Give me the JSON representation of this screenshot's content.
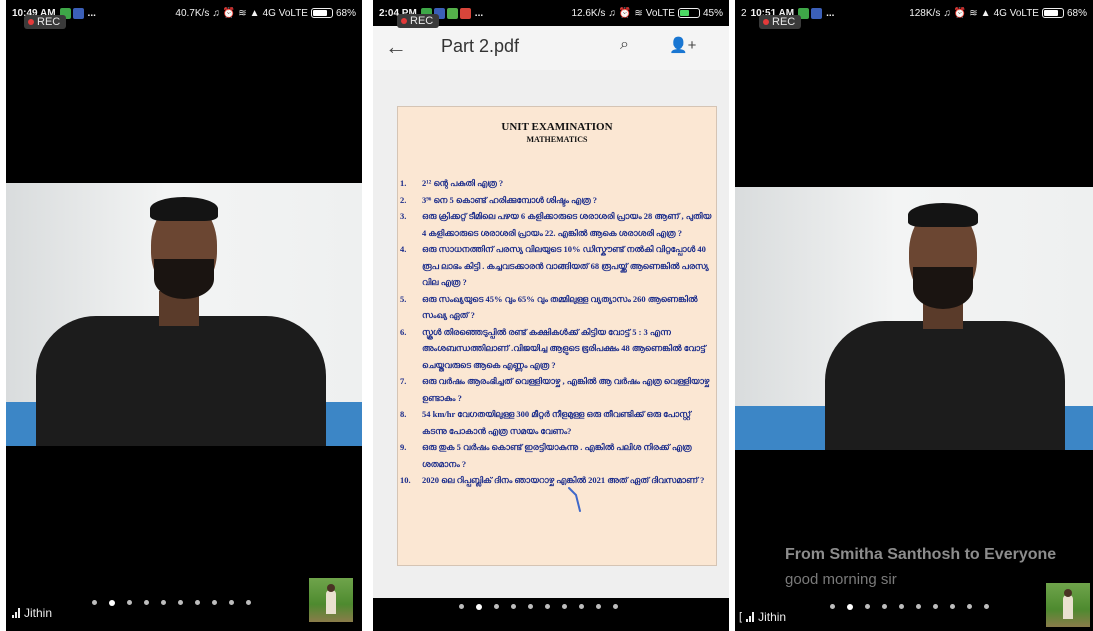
{
  "colors": {
    "rec_dot": "#e43a3a",
    "doc_text": "#182a8a",
    "floor_blue": "#3c86c6"
  },
  "panel1": {
    "status": {
      "time": "10:49 AM",
      "icons": [
        "gallery-icon",
        "facebook-icon"
      ],
      "more": "...",
      "speed": "40.7K/s",
      "network": "4G VoLTE",
      "battery": "68%",
      "battery_level": 0.68
    },
    "rec": "REC",
    "participant_name": "Jithin",
    "page_count": 10,
    "active_page": 1
  },
  "panel2": {
    "status": {
      "time": "2:04 PM",
      "icons": [
        "gallery-icon",
        "facebook-icon",
        "chat-icon",
        "mail-icon"
      ],
      "more": "...",
      "speed": "12.6K/s",
      "network": "VoLTE",
      "battery": "45%",
      "battery_level": 0.45
    },
    "rec": "REC",
    "app_title": "Part 2.pdf",
    "document": {
      "title": "UNIT EXAMINATION",
      "subtitle": "MATHEMATICS",
      "questions": [
        {
          "num": "1.",
          "text": "2¹² ന്റെ പകുതി എത്ര ?"
        },
        {
          "num": "2.",
          "text": "3⁹⁶ നെ 5 കൊണ്ട് ഹരിക്കുമ്പോൾ ശിഷ്ടം എത്ര ?"
        },
        {
          "num": "3.",
          "text": "ഒരു ക്രിക്കറ്റ് ടീമിലെ പഴയ 6 കളിക്കാരുടെ ശരാശരി പ്രായം 28 ആണ് , പുതിയ 4 കളിക്കാരുടെ ശരാശരി പ്രായം 22. എങ്കിൽ ആകെ ശരാശരി എത്ര ?"
        },
        {
          "num": "4.",
          "text": "ഒരു സാധനത്തിന് പരസ്യ വിലയുടെ 10% ഡിസ്കൗണ്ട് നൽകി വിറ്റപ്പോൾ 40 രൂപ ലാഭം കിട്ടി . കച്ചവടക്കാരൻ വാങ്ങിയത് 68 രൂപയ്ക്ക് ആണെങ്കിൽ പരസ്യ വില എത്ര ?"
        },
        {
          "num": "5.",
          "text": "ഒരു സംഖ്യയുടെ 45% വും 65% വും തമ്മിലുള്ള വ്യത്യാസം 260 ആണെങ്കിൽ സംഖ്യ ഏത് ?"
        },
        {
          "num": "6.",
          "text": "സ്കൂൾ തിരഞ്ഞെടുപ്പിൽ രണ്ട് കക്ഷികൾക്ക് കിട്ടിയ വോട്ട് 5 : 3 എന്ന അംശബന്ധത്തിലാണ് .വിജയിച്ച ആളുടെ ഭൂരിപക്ഷം 48 ആണെങ്കിൽ വോട്ട് ചെയ്തവരുടെ ആകെ എണ്ണം എത്ര ?"
        },
        {
          "num": "7.",
          "text": "ഒരു വർഷം ആരംഭിച്ചത് വെള്ളിയാഴ്ച , എങ്കിൽ ആ വർഷം എത്ര വെള്ളിയാഴ്ച ഉണ്ടാകും ?"
        },
        {
          "num": "8.",
          "text": "54 km/hr വേഗതയിലുള്ള 300 മീറ്റർ നീളമുള്ള ഒരു തീവണ്ടിക്ക് ഒരു പോസ്റ്റ് കടന്നു പോകാൻ എത്ര സമയം വേണം?"
        },
        {
          "num": "9.",
          "text": "ഒരു തുക 5 വർഷം കൊണ്ട് ഇരട്ടിയാകുന്നു . എങ്കിൽ പലിശ നിരക്ക് എത്ര ശതമാനം ?"
        },
        {
          "num": "10.",
          "text": "2020 ലെ റിപ്പബ്ലിക് ദിനം ഞായറാഴ്ച എങ്കിൽ 2021 അത് ഏത് ദിവസമാണ് ?"
        }
      ]
    },
    "page_count": 10,
    "active_page": 1
  },
  "panel3": {
    "status": {
      "index": "2",
      "time": "10:51 AM",
      "icons": [
        "gallery-icon",
        "facebook-icon"
      ],
      "more": "...",
      "speed": "128K/s",
      "network": "4G VoLTE",
      "battery": "68%",
      "battery_level": 0.68
    },
    "rec": "REC",
    "chat": {
      "from": "From Smitha Santhosh to Everyone",
      "message": "good morning sir"
    },
    "participant_name": "Jithin",
    "page_count": 10,
    "active_page": 1
  }
}
